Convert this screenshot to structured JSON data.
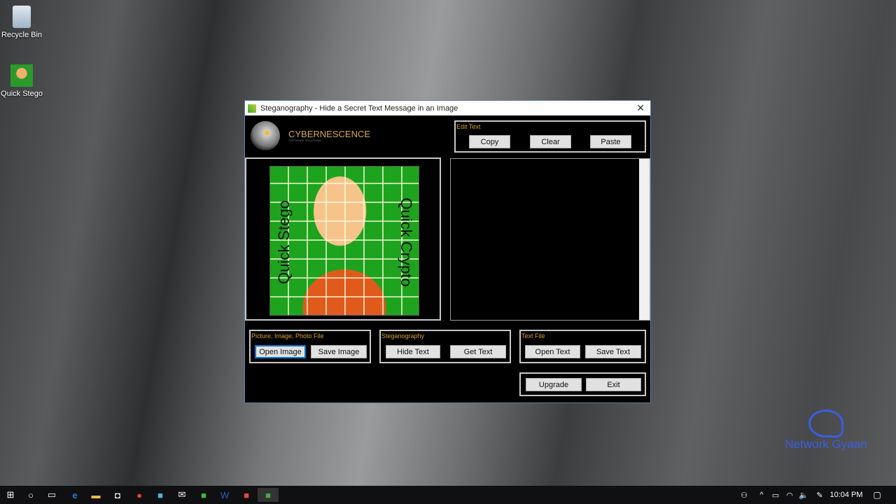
{
  "desktop": {
    "icons": [
      {
        "label": "Recycle Bin"
      },
      {
        "label": "Quick Stego"
      }
    ],
    "watermark": "Network Gyaan"
  },
  "window": {
    "title": "Steganography - Hide a Secret Text Message in an Image",
    "logo": {
      "name": "CYBERNESCENCE",
      "tagline": "SOFTWARE SOLUTIONS"
    },
    "edit_text": {
      "label": "Edit Text",
      "copy": "Copy",
      "clear": "Clear",
      "paste": "Paste"
    },
    "image_text": {
      "left": "Quick Stego",
      "right": "Quick Crypto"
    },
    "text_area": "",
    "picture": {
      "label": "Picture, Image, Photo File",
      "open": "Open Image",
      "save": "Save Image"
    },
    "stego": {
      "label": "Steganography",
      "hide": "Hide Text",
      "get": "Get Text"
    },
    "textfile": {
      "label": "Text File",
      "open": "Open Text",
      "save": "Save Text"
    },
    "upgrade": "Upgrade",
    "exit": "Exit"
  },
  "taskbar": {
    "time": "10:04 PM"
  }
}
